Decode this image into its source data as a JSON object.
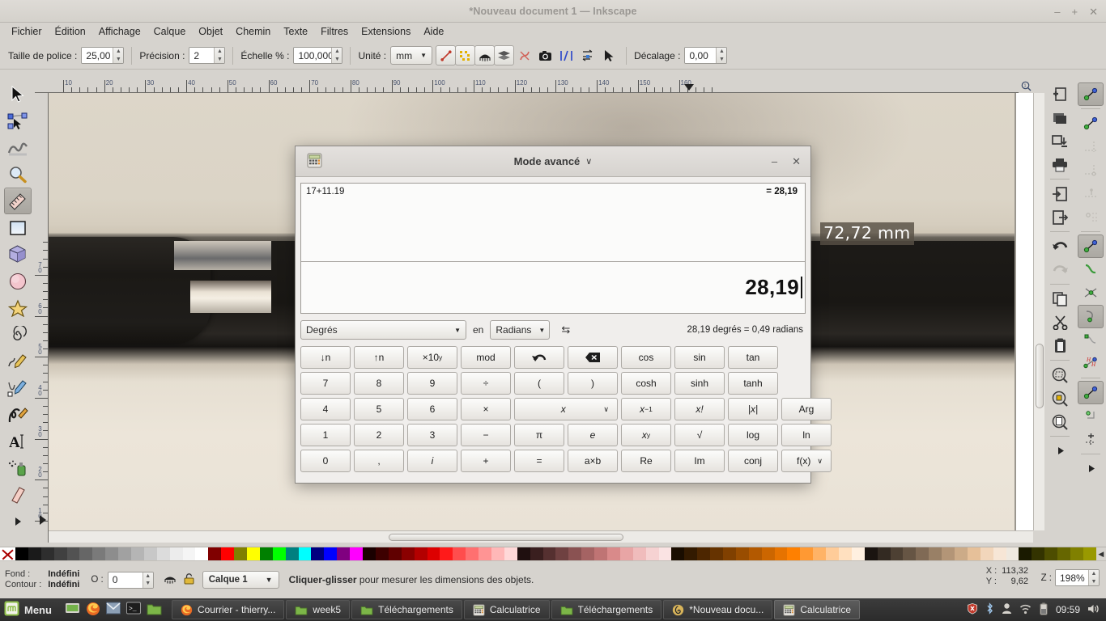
{
  "window": {
    "title": "*Nouveau document 1 — Inkscape",
    "minimize": "–",
    "maximize": "+",
    "close": "✕"
  },
  "menubar": {
    "items": [
      {
        "label": "Fichier"
      },
      {
        "label": "Édition"
      },
      {
        "label": "Affichage"
      },
      {
        "label": "Calque"
      },
      {
        "label": "Objet"
      },
      {
        "label": "Chemin"
      },
      {
        "label": "Texte"
      },
      {
        "label": "Filtres"
      },
      {
        "label": "Extensions"
      },
      {
        "label": "Aide"
      }
    ]
  },
  "tool_options": {
    "font_size_label": "Taille de police :",
    "font_size_value": "25,00",
    "precision_label": "Précision :",
    "precision_value": "2",
    "scale_label": "Échelle % :",
    "scale_value": "100,000",
    "unit_label": "Unité :",
    "unit_value": "mm",
    "offset_label": "Décalage :",
    "offset_value": "0,00",
    "buttons": [
      {
        "name": "measure-line-icon"
      },
      {
        "name": "ignore-first-last-icon"
      },
      {
        "name": "show-measures-icon"
      },
      {
        "name": "measure-all-layers-icon"
      },
      {
        "name": "reverse-measure-icon"
      },
      {
        "name": "phantom-measure-icon"
      },
      {
        "name": "to-guides-icon"
      },
      {
        "name": "mark-dimension-icon"
      },
      {
        "name": "convert-to-item-icon"
      }
    ]
  },
  "toolbox": {
    "tools": [
      {
        "name": "selector-tool",
        "selected": false
      },
      {
        "name": "node-tool",
        "selected": false
      },
      {
        "name": "tweak-tool",
        "selected": false
      },
      {
        "name": "zoom-tool",
        "selected": false
      },
      {
        "name": "measure-tool",
        "selected": true
      },
      {
        "name": "rectangle-tool",
        "selected": false
      },
      {
        "name": "3dbox-tool",
        "selected": false
      },
      {
        "name": "ellipse-tool",
        "selected": false
      },
      {
        "name": "star-tool",
        "selected": false
      },
      {
        "name": "spiral-tool",
        "selected": false
      },
      {
        "name": "pencil-tool",
        "selected": false
      },
      {
        "name": "bezier-tool",
        "selected": false
      },
      {
        "name": "calligraphy-tool",
        "selected": false
      },
      {
        "name": "text-tool",
        "selected": false
      },
      {
        "name": "spray-tool",
        "selected": false
      },
      {
        "name": "eraser-tool",
        "selected": false
      },
      {
        "name": "toolbox-overflow-arrow",
        "selected": false
      }
    ]
  },
  "commands_bar": {
    "items": [
      {
        "name": "new-document-icon"
      },
      {
        "name": "open-document-icon"
      },
      {
        "name": "save-document-icon"
      },
      {
        "name": "print-document-icon"
      },
      {
        "name": "import-icon"
      },
      {
        "name": "export-icon"
      },
      {
        "name": "undo-icon"
      },
      {
        "name": "redo-icon"
      },
      {
        "name": "copy-icon"
      },
      {
        "name": "cut-icon"
      },
      {
        "name": "paste-icon"
      },
      {
        "name": "zoom-selection-icon"
      },
      {
        "name": "zoom-drawing-icon"
      },
      {
        "name": "zoom-page-icon"
      },
      {
        "name": "commands-overflow-arrow"
      }
    ]
  },
  "snap_bar": {
    "items": [
      {
        "name": "enable-snapping-icon",
        "selected": true
      },
      {
        "name": "snap-bounding-box-icon",
        "selected": false
      },
      {
        "name": "snap-bbox-edges-icon",
        "selected": false
      },
      {
        "name": "snap-bbox-corners-icon",
        "selected": false
      },
      {
        "name": "snap-bbox-edge-midpoints-icon",
        "selected": false
      },
      {
        "name": "snap-bbox-centers-icon",
        "selected": false
      },
      {
        "name": "snap-nodes-paths-icon",
        "selected": true
      },
      {
        "name": "snap-to-paths-icon",
        "selected": false
      },
      {
        "name": "snap-path-intersections-icon",
        "selected": false
      },
      {
        "name": "snap-to-cusp-nodes-icon",
        "selected": true
      },
      {
        "name": "snap-smooth-nodes-icon",
        "selected": false
      },
      {
        "name": "snap-midpoints-icon",
        "selected": false
      },
      {
        "name": "snap-others-icon",
        "selected": true
      },
      {
        "name": "snap-object-centers-icon",
        "selected": false
      },
      {
        "name": "snap-page-border-icon",
        "selected": false
      },
      {
        "name": "snap-overflow-arrow",
        "selected": false
      }
    ]
  },
  "rulers": {
    "horizontal_labels": [
      "10",
      "20",
      "30",
      "40",
      "50",
      "60",
      "70",
      "80",
      "90",
      "100",
      "110",
      "120",
      "130",
      "140",
      "150",
      "160"
    ],
    "vertical_labels": [
      "10",
      "20",
      "30",
      "40",
      "50",
      "60",
      "70"
    ],
    "lock_icon": "ruler-lock-icon",
    "zoom_icon": "ruler-zoom-icon"
  },
  "canvas": {
    "measure_label": "72,72 mm"
  },
  "palette": {
    "colors": [
      "#000000",
      "#1a1a1a",
      "#2e2e2e",
      "#404040",
      "#525252",
      "#666666",
      "#7a7a7a",
      "#8d8d8d",
      "#a1a1a1",
      "#b5b5b5",
      "#c8c8c8",
      "#dcdcdc",
      "#ececec",
      "#f5f5f5",
      "#ffffff",
      "#800000",
      "#ff0000",
      "#808000",
      "#ffff00",
      "#008000",
      "#00ff00",
      "#008080",
      "#00ffff",
      "#000080",
      "#0000ff",
      "#800080",
      "#ff00ff",
      "#1a0000",
      "#3d0000",
      "#600000",
      "#8a0000",
      "#b30000",
      "#dd0000",
      "#ff1a1a",
      "#ff4d4d",
      "#ff7070",
      "#ff9494",
      "#ffb8b8",
      "#ffd8d8",
      "#1f0f0f",
      "#3a1f1f",
      "#553030",
      "#6f4141",
      "#8a5252",
      "#a56363",
      "#bf7474",
      "#d98a8a",
      "#e8a5a5",
      "#f0bcbc",
      "#f6d2d2",
      "#fae3e3",
      "#1a0d00",
      "#331a00",
      "#4d2600",
      "#663300",
      "#804000",
      "#994d00",
      "#b35900",
      "#cc6600",
      "#e67300",
      "#ff8000",
      "#ff9933",
      "#ffb366",
      "#ffcc99",
      "#ffe0bf",
      "#fff0e0",
      "#1a1410",
      "#332a22",
      "#4d4033",
      "#665544",
      "#806a55",
      "#998066",
      "#b39577",
      "#ccab88",
      "#e6c099",
      "#f2d6bb",
      "#f7e6d6",
      "#efe9e0",
      "#1a1a00",
      "#333300",
      "#4d4d00",
      "#666600",
      "#808000",
      "#999900"
    ],
    "none_swatch": "none-color-swatch"
  },
  "statusbar": {
    "fill_label": "Fond :",
    "fill_value": "Indéfini",
    "stroke_label": "Contour :",
    "stroke_value": "Indéfini",
    "opacity_label": "O :",
    "opacity_value": "0",
    "layer_name": "Calque 1",
    "hint_bold": "Cliquer-glisser",
    "hint_rest": " pour mesurer les dimensions des objets.",
    "coord_x_label": "X :",
    "coord_x_value": "113,32",
    "coord_y_label": "Y :",
    "coord_y_value": "9,62",
    "zoom_label": "Z :",
    "zoom_value": "198%",
    "eye_icon": "layer-visibility-icon",
    "lock_icon": "layer-lock-icon"
  },
  "calculator": {
    "title": "Mode avancé",
    "title_caret": "∨",
    "app_icon": "calculator-icon",
    "minimize": "–",
    "close": "✕",
    "history_expression": "17+11.19",
    "history_result": "= 28,19",
    "current_value": "28,19",
    "converter": {
      "from_unit": "Degrés",
      "middle_label": "en",
      "to_unit": "Radians",
      "swap_icon": "swap-units-icon",
      "result": "28,19 degrés = 0,49 radians"
    },
    "keys": [
      [
        {
          "label": "↓n",
          "name": "subscript-key"
        },
        {
          "label": "↑n",
          "name": "superscript-key"
        },
        {
          "label": "×10",
          "sup": "y",
          "name": "exponent-key"
        },
        {
          "label": "mod",
          "name": "modulus-key"
        },
        {
          "label": "",
          "name": "undo-icon",
          "icon": "undo"
        },
        {
          "label": "",
          "name": "backspace-icon",
          "icon": "backspace"
        },
        {
          "label": "cos",
          "name": "cos-key"
        },
        {
          "label": "sin",
          "name": "sin-key"
        },
        {
          "label": "tan",
          "name": "tan-key"
        }
      ],
      [
        {
          "label": "7",
          "name": "digit-7-key"
        },
        {
          "label": "8",
          "name": "digit-8-key"
        },
        {
          "label": "9",
          "name": "digit-9-key"
        },
        {
          "label": "÷",
          "name": "divide-key"
        },
        {
          "label": "(",
          "name": "open-paren-key"
        },
        {
          "label": ")",
          "name": "close-paren-key"
        },
        {
          "label": "cosh",
          "name": "cosh-key"
        },
        {
          "label": "sinh",
          "name": "sinh-key"
        },
        {
          "label": "tanh",
          "name": "tanh-key"
        }
      ],
      [
        {
          "label": "4",
          "name": "digit-4-key"
        },
        {
          "label": "5",
          "name": "digit-5-key"
        },
        {
          "label": "6",
          "name": "digit-6-key"
        },
        {
          "label": "×",
          "name": "multiply-key"
        },
        {
          "label": "x",
          "name": "variable-x-key",
          "wide": true,
          "caret": true,
          "italic": true
        },
        {
          "label": "x",
          "sup": "−1",
          "name": "inverse-key",
          "italic": true
        },
        {
          "label": "x!",
          "name": "factorial-key",
          "italic": true
        },
        {
          "label": "|x|",
          "name": "absolute-key",
          "italic": true
        },
        {
          "label": "Arg",
          "name": "argument-key"
        }
      ],
      [
        {
          "label": "1",
          "name": "digit-1-key"
        },
        {
          "label": "2",
          "name": "digit-2-key"
        },
        {
          "label": "3",
          "name": "digit-3-key"
        },
        {
          "label": "−",
          "name": "subtract-key"
        },
        {
          "label": "π",
          "name": "pi-key"
        },
        {
          "label": "e",
          "name": "euler-key",
          "italic": true
        },
        {
          "label": "x",
          "sup": "y",
          "name": "power-key",
          "italic": true
        },
        {
          "label": "√",
          "name": "sqrt-key"
        },
        {
          "label": "log",
          "name": "log-key"
        },
        {
          "label": "ln",
          "name": "ln-key"
        }
      ],
      [
        {
          "label": "0",
          "name": "digit-0-key"
        },
        {
          "label": ",",
          "name": "decimal-point-key"
        },
        {
          "label": "i",
          "name": "imaginary-key",
          "italic": true
        },
        {
          "label": "+",
          "name": "add-key"
        },
        {
          "label": "=",
          "name": "equals-key"
        },
        {
          "label": "a×b",
          "name": "multiply-ab-key"
        },
        {
          "label": "Re",
          "name": "real-part-key"
        },
        {
          "label": "Im",
          "name": "imaginary-part-key"
        },
        {
          "label": "conj",
          "name": "conjugate-key"
        },
        {
          "label": "f(x)",
          "name": "functions-key",
          "caret": true
        }
      ]
    ]
  },
  "taskbar": {
    "menu_label": "Menu",
    "menu_icon": "linux-mint-icon",
    "quick_launch": [
      {
        "name": "show-desktop-icon"
      },
      {
        "name": "firefox-icon"
      },
      {
        "name": "mail-icon"
      },
      {
        "name": "terminal-icon"
      },
      {
        "name": "files-icon"
      }
    ],
    "tasks": [
      {
        "label": "Courrier - thierry...",
        "icon": "firefox-icon",
        "active": false
      },
      {
        "label": "week5",
        "icon": "folder-icon",
        "active": false
      },
      {
        "label": "Téléchargements",
        "icon": "folder-icon",
        "active": false
      },
      {
        "label": "Calculatrice",
        "icon": "calculator-icon",
        "active": false
      },
      {
        "label": "Téléchargements",
        "icon": "folder-icon",
        "active": false
      },
      {
        "label": "*Nouveau docu...",
        "icon": "inkscape-icon",
        "active": false
      },
      {
        "label": "Calculatrice",
        "icon": "calculator-icon",
        "active": true
      }
    ],
    "tray": [
      {
        "name": "shield-icon"
      },
      {
        "name": "bluetooth-icon"
      },
      {
        "name": "user-icon"
      },
      {
        "name": "wifi-icon"
      },
      {
        "name": "battery-icon"
      }
    ],
    "clock": "09:59",
    "volume_icon": "volume-icon"
  }
}
